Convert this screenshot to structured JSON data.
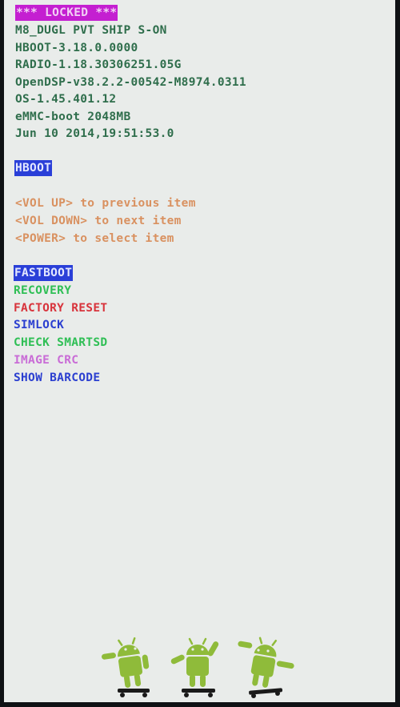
{
  "status": {
    "locked_label": "*** LOCKED ***",
    "locked_bg": "#c41fd1",
    "locked_fg": "#f2d0f5"
  },
  "device_info": [
    "M8_DUGL PVT SHIP S-ON",
    "HBOOT-3.18.0.0000",
    "RADIO-1.18.30306251.05G",
    "OpenDSP-v38.2.2-00542-M8974.0311",
    "OS-1.45.401.12",
    "eMMC-boot 2048MB",
    "Jun 10 2014,19:51:53.0"
  ],
  "section": {
    "title": "HBOOT",
    "title_bg": "#2a3fd8",
    "title_fg": "#e4e8ff"
  },
  "instructions": [
    "<VOL UP> to previous item",
    "<VOL DOWN> to next item",
    "<POWER> to select item"
  ],
  "menu": {
    "items": [
      {
        "label": "FASTBOOT",
        "color": "#e4e8ff",
        "bg": "#2a3fd8",
        "selected": true
      },
      {
        "label": "RECOVERY",
        "color": "#2fbf55"
      },
      {
        "label": "FACTORY RESET",
        "color": "#d8343c"
      },
      {
        "label": "SIMLOCK",
        "color": "#2b3fd0"
      },
      {
        "label": "CHECK SMARTSD",
        "color": "#2fbf55"
      },
      {
        "label": "IMAGE CRC",
        "color": "#c96cd6"
      },
      {
        "label": "SHOW BARCODE",
        "color": "#2b3fd0"
      }
    ]
  },
  "icons": [
    "android-skateboard-icon",
    "android-skateboard-icon",
    "android-skateboard-icon"
  ],
  "colors": {
    "info_text": "#2f6e4c",
    "instruction_text": "#d99160",
    "android_green": "#8fbb3a",
    "skateboard": "#1a1a1a",
    "screen_bg": "#e9ecea"
  }
}
